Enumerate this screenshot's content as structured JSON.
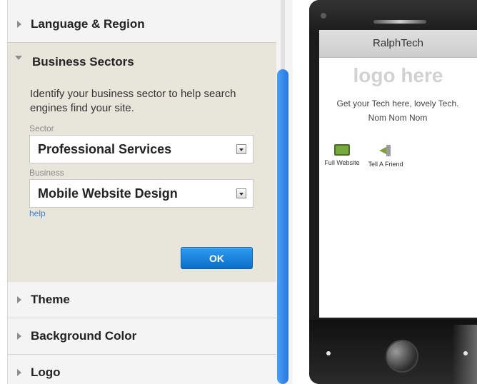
{
  "accordion": {
    "language_region": "Language & Region",
    "business_sectors": {
      "title": "Business Sectors",
      "description": "Identify your business sector to help search engines find your site.",
      "sector_label": "Sector",
      "sector_value": "Professional Services",
      "business_label": "Business",
      "business_value": "Mobile Website Design",
      "help_link": "help",
      "ok_button": "OK"
    },
    "theme": "Theme",
    "background_color": "Background Color",
    "logo": "Logo"
  },
  "phone_preview": {
    "site_title": "RalphTech",
    "logo_placeholder": "logo here",
    "tagline": "Get your Tech here, lovely Tech. Nom Nom Nom",
    "shortcuts": [
      {
        "label": "Full Website",
        "icon": "monitor-icon"
      },
      {
        "label": "Tell A Friend",
        "icon": "megaphone-icon"
      }
    ]
  },
  "colors": {
    "accent_blue": "#1a84e0",
    "panel_open_bg": "#e8e5da",
    "panel_bg": "#f4f4f4"
  }
}
